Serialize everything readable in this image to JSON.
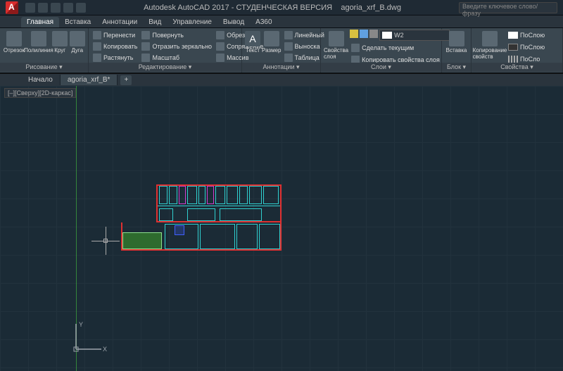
{
  "title": {
    "app": "Autodesk AutoCAD 2017 - СТУДЕНЧЕСКАЯ ВЕРСИЯ",
    "file": "agoria_xrf_B.dwg"
  },
  "search": {
    "placeholder": "Введите ключевое слово/фразу"
  },
  "tabs": {
    "t0": "Главная",
    "t1": "Вставка",
    "t2": "Аннотации",
    "t3": "Вид",
    "t4": "Управление",
    "t5": "Вывод",
    "t6": "A360"
  },
  "draw": {
    "title": "Рисование ▾",
    "line": "Отрезок",
    "polyline": "Полилиния",
    "circle": "Круг",
    "arc": "Дуга"
  },
  "modify": {
    "title": "Редактирование ▾",
    "move": "Перенести",
    "copy": "Копировать",
    "stretch": "Растянуть",
    "rotate": "Повернуть",
    "mirror": "Отразить зеркально",
    "scale": "Масштаб",
    "trim": "Обрезать",
    "fillet": "Сопряжение",
    "array": "Массив"
  },
  "annot": {
    "title": "Аннотации ▾",
    "text": "Текст",
    "dim": "Размер",
    "dimlin": "Линейный",
    "leader": "Выноска",
    "table": "Таблица"
  },
  "layers": {
    "title": "Слои ▾",
    "props": "Свойства слоя",
    "current": "W2",
    "setcur": "Сделать текущим",
    "match": "Копировать свойства слоя"
  },
  "block": {
    "title": "Блок ▾",
    "insert": "Вставка"
  },
  "props": {
    "title": "Свойства ▾",
    "match": "Копирование свойств",
    "bylayer": "ПоСлою",
    "bylayer2": "ПоСлою",
    "bylayer3": "ПоСло"
  },
  "filetabs": {
    "start": "Начало",
    "f1": "agoria_xrf_B*",
    "add": "+"
  },
  "viewport": {
    "label": "[–][Сверху][2D-каркас]",
    "axis_x": "X",
    "axis_y": "Y"
  }
}
